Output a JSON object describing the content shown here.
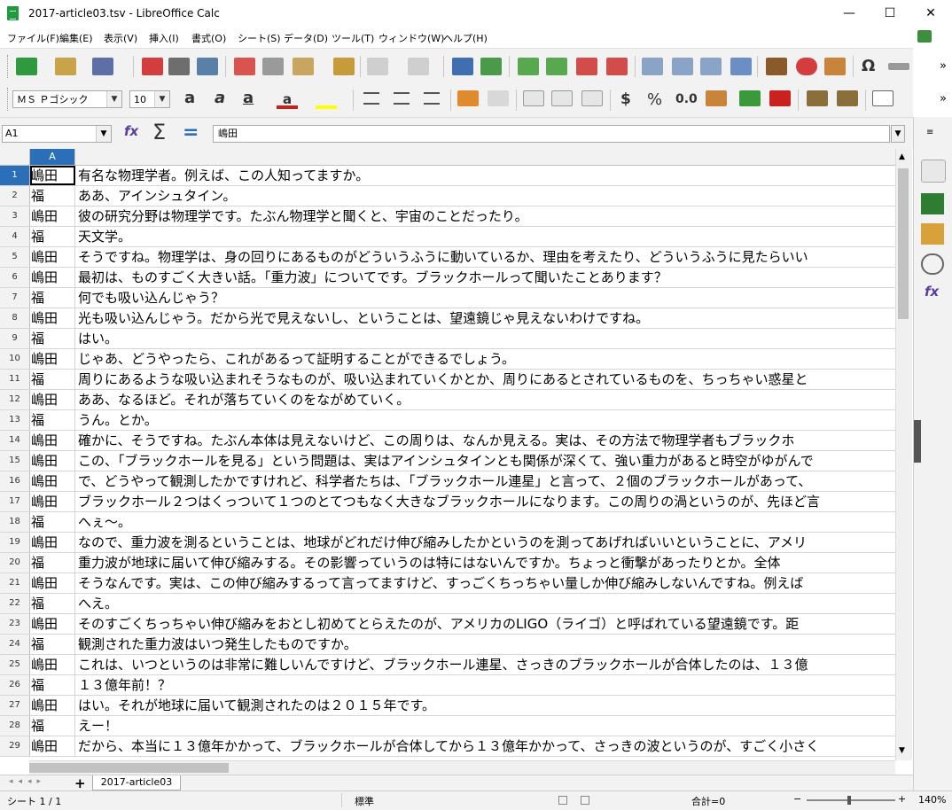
{
  "window": {
    "title": "2017-article03.tsv - LibreOffice Calc",
    "min_glyph": "—",
    "max_glyph": "☐",
    "close_glyph": "✕"
  },
  "menu": [
    "ファイル(F)",
    "編集(E)",
    "表示(V)",
    "挿入(I)",
    "書式(O)",
    "シート(S)",
    "データ(D)",
    "ツール(T)",
    "ウィンドウ(W)",
    "ヘルプ(H)"
  ],
  "toolbar": {
    "font_name": "ＭＳ Ｐゴシック",
    "font_size": "10",
    "currency": "$",
    "percent": "%",
    "decimal": "0.0",
    "more": "»"
  },
  "formula": {
    "name_box": "A1",
    "content": "嶋田"
  },
  "sheet": {
    "column_header": "A",
    "rows": [
      {
        "n": "1",
        "a": "嶋田",
        "b": "有名な物理学者。例えば、この人知ってますか。"
      },
      {
        "n": "2",
        "a": "福",
        "b": "ああ、アインシュタイン。"
      },
      {
        "n": "3",
        "a": "嶋田",
        "b": "彼の研究分野は物理学です。たぶん物理学と聞くと、宇宙のことだったり。"
      },
      {
        "n": "4",
        "a": "福",
        "b": "天文学。"
      },
      {
        "n": "5",
        "a": "嶋田",
        "b": "そうですね。物理学は、身の回りにあるものがどういうふうに動いているか、理由を考えたり、どういうふうに見たらいい"
      },
      {
        "n": "6",
        "a": "嶋田",
        "b": "最初は、ものすごく大きい話。「重力波」についてです。ブラックホールって聞いたことあります？"
      },
      {
        "n": "7",
        "a": "福",
        "b": "何でも吸い込んじゃう？"
      },
      {
        "n": "8",
        "a": "嶋田",
        "b": "光も吸い込んじゃう。だから光で見えないし、ということは、望遠鏡じゃ見えないわけですね。"
      },
      {
        "n": "9",
        "a": "福",
        "b": "はい。"
      },
      {
        "n": "10",
        "a": "嶋田",
        "b": "じゃあ、どうやったら、これがあるって証明することができるでしょう。"
      },
      {
        "n": "11",
        "a": "福",
        "b": "周りにあるような吸い込まれそうなものが、吸い込まれていくかとか、周りにあるとされているものを、ちっちゃい惑星と"
      },
      {
        "n": "12",
        "a": "嶋田",
        "b": "ああ、なるほど。それが落ちていくのをながめていく。"
      },
      {
        "n": "13",
        "a": "福",
        "b": "うん。とか。"
      },
      {
        "n": "14",
        "a": "嶋田",
        "b": "確かに、そうですね。たぶん本体は見えないけど、この周りは、なんか見える。実は、その方法で物理学者もブラックホ"
      },
      {
        "n": "15",
        "a": "嶋田",
        "b": "この、「ブラックホールを見る」という問題は、実はアインシュタインとも関係が深くて、強い重力があると時空がゆがんで"
      },
      {
        "n": "16",
        "a": "嶋田",
        "b": "で、どうやって観測したかですけれど、科学者たちは、「ブラックホール連星」と言って、２個のブラックホールがあって、"
      },
      {
        "n": "17",
        "a": "嶋田",
        "b": "ブラックホール２つはくっついて１つのとてつもなく大きなブラックホールになります。この周りの渦というのが、先ほど言"
      },
      {
        "n": "18",
        "a": "福",
        "b": "へぇ〜。"
      },
      {
        "n": "19",
        "a": "嶋田",
        "b": "なので、重力波を測るということは、地球がどれだけ伸び縮みしたかというのを測ってあげればいいということに、アメリ"
      },
      {
        "n": "20",
        "a": "福",
        "b": "重力波が地球に届いて伸び縮みする。その影響っていうのは特にはないんですか。ちょっと衝撃があったりとか。全体"
      },
      {
        "n": "21",
        "a": "嶋田",
        "b": "そうなんです。実は、この伸び縮みするって言ってますけど、すっごくちっちゃい量しか伸び縮みしないんですね。例えば"
      },
      {
        "n": "22",
        "a": "福",
        "b": "へえ。"
      },
      {
        "n": "23",
        "a": "嶋田",
        "b": "そのすごくちっちゃい伸び縮みをおとし初めてとらえたのが、アメリカのLIGO（ライゴ）と呼ばれている望遠鏡です。距"
      },
      {
        "n": "24",
        "a": "福",
        "b": "観測された重力波はいつ発生したものですか。"
      },
      {
        "n": "25",
        "a": "嶋田",
        "b": "これは、いつというのは非常に難しいんですけど、ブラックホール連星、さっきのブラックホールが合体したのは、１３億"
      },
      {
        "n": "26",
        "a": "福",
        "b": "１３億年前！？"
      },
      {
        "n": "27",
        "a": "嶋田",
        "b": "はい。それが地球に届いて観測されたのは２０１５年です。"
      },
      {
        "n": "28",
        "a": "福",
        "b": "えー！"
      },
      {
        "n": "29",
        "a": "嶋田",
        "b": "だから、本当に１３億年かかって、ブラックホールが合体してから１３億年かかって、さっきの波というのが、すごく小さく"
      }
    ]
  },
  "tabs": {
    "add": "+",
    "sheet_name": "2017-article03"
  },
  "status": {
    "sheet_pos": "シート 1 / 1",
    "style": "標準",
    "sum": "合計=0",
    "zoom": "140%",
    "minus": "−",
    "plus": "+"
  }
}
